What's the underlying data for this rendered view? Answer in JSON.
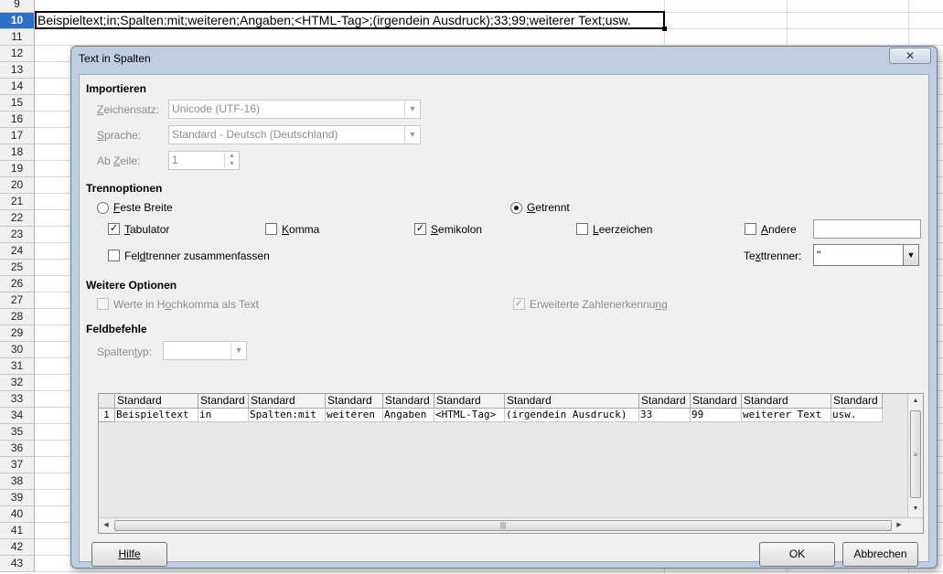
{
  "sheet": {
    "rows": [
      "9",
      "10",
      "11",
      "12",
      "13",
      "14",
      "15",
      "16",
      "17",
      "18",
      "19",
      "20",
      "21",
      "22",
      "23",
      "24",
      "25",
      "26",
      "27",
      "28",
      "29",
      "30",
      "31",
      "32",
      "33",
      "34",
      "35",
      "36",
      "37",
      "38",
      "39",
      "40",
      "41",
      "42",
      "43"
    ],
    "active_row": "10",
    "active_cell_text": "Beispieltext;in;Spalten:mit;weiteren;Angaben;<HTML-Tag>;(irgendein Ausdruck);33;99;weiterer Text;usw."
  },
  "dialog": {
    "title": "Text in Spalten",
    "close_label": "✕",
    "import": {
      "heading": "Importieren",
      "charset_label": "Zeichensatz:",
      "charset_value": "Unicode (UTF-16)",
      "language_label": "Sprache:",
      "language_value": "Standard - Deutsch (Deutschland)",
      "from_row_label": "Ab Zeile:",
      "from_row_value": "1"
    },
    "separator": {
      "heading": "Trennoptionen",
      "fixed_width_label": "Feste Breite",
      "separated_label": "Getrennt",
      "mode": "separated",
      "tab_label": "Tabulator",
      "tab_checked": true,
      "comma_label": "Komma",
      "comma_checked": false,
      "semicolon_label": "Semikolon",
      "semicolon_checked": true,
      "space_label": "Leerzeichen",
      "space_checked": false,
      "other_label": "Andere",
      "other_checked": false,
      "other_value": "",
      "merge_label": "Feldtrenner zusammenfassen",
      "merge_checked": false,
      "text_delimiter_label": "Texttrenner:",
      "text_delimiter_value": "\""
    },
    "other_options": {
      "heading": "Weitere Optionen",
      "quoted_as_text_label": "Werte in Hochkomma als Text",
      "detect_numbers_label": "Erweiterte Zahlenerkennung"
    },
    "fields": {
      "heading": "Feldbefehle",
      "column_type_label": "Spaltentyp:",
      "column_type_value": "",
      "headers": [
        "Standard",
        "Standard",
        "Standard",
        "Standard",
        "Standard",
        "Standard",
        "Standard",
        "Standard",
        "Standard",
        "Standard",
        "Standard"
      ],
      "row_number": "1",
      "cells": [
        "Beispieltext",
        "in",
        "Spalten:mit",
        "weiteren",
        "Angaben",
        "<HTML-Tag>",
        "(irgendein Ausdruck)",
        "33",
        "99",
        "weiterer Text",
        "usw."
      ]
    },
    "buttons": {
      "help": "Hilfe",
      "ok": "OK",
      "cancel": "Abbrechen"
    }
  }
}
